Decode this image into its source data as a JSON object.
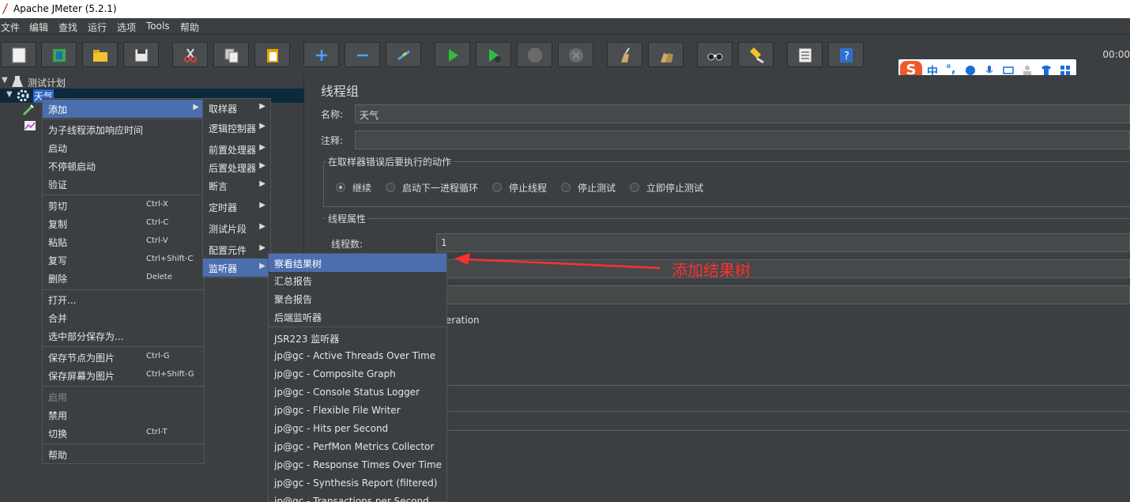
{
  "window": {
    "title": "Apache JMeter (5.2.1)"
  },
  "menubar": {
    "items": [
      "文件",
      "编辑",
      "查找",
      "运行",
      "选项",
      "Tools",
      "帮助"
    ]
  },
  "toolbar": {
    "buttons": [
      "new-icon",
      "templates-icon",
      "open-icon",
      "save-icon",
      "cut-icon",
      "copy-icon",
      "paste-icon",
      "expand-icon",
      "collapse-icon",
      "toggle-icon",
      "start-icon",
      "start-no-pause-icon",
      "stop-icon",
      "shutdown-icon",
      "clear-icon",
      "clear-all-icon",
      "search-icon",
      "reset-search-icon",
      "function-helper-icon",
      "help-icon"
    ],
    "timer": "00:00"
  },
  "ime": {
    "logo": "S",
    "lang": "中",
    "punct": "°,",
    "icons": [
      "emoji-icon",
      "mic-icon",
      "keyboard-icon",
      "user-icon",
      "shirt-icon",
      "apps-icon"
    ]
  },
  "tree": {
    "plan_label": "测试计划",
    "group_label": "天气"
  },
  "right_panel": {
    "title": "线程组",
    "name_label": "名称:",
    "name_value": "天气",
    "comment_label": "注释:",
    "comment_value": "",
    "error_action_title": "在取样器错误后要执行的动作",
    "error_actions": [
      "继续",
      "启动下一进程循环",
      "停止线程",
      "停止测试",
      "立即停止测试"
    ],
    "error_action_selected": 0,
    "thread_props_title": "线程属性",
    "thread_count_label": "线程数:",
    "thread_count_value": "1",
    "partial_text": "eration"
  },
  "context_menu": {
    "items": [
      {
        "label": "添加",
        "shortcut": "",
        "submenu": true
      },
      {
        "label": "为子线程添加响应时间",
        "shortcut": ""
      },
      {
        "label": "启动",
        "shortcut": ""
      },
      {
        "label": "不停顿启动",
        "shortcut": ""
      },
      {
        "label": "验证",
        "shortcut": ""
      },
      {
        "label": "剪切",
        "shortcut": "Ctrl-X"
      },
      {
        "label": "复制",
        "shortcut": "Ctrl-C"
      },
      {
        "label": "粘贴",
        "shortcut": "Ctrl-V"
      },
      {
        "label": "复写",
        "shortcut": "Ctrl+Shift-C"
      },
      {
        "label": "删除",
        "shortcut": "Delete"
      },
      {
        "label": "打开...",
        "shortcut": ""
      },
      {
        "label": "合并",
        "shortcut": ""
      },
      {
        "label": "选中部分保存为...",
        "shortcut": ""
      },
      {
        "label": "保存节点为图片",
        "shortcut": "Ctrl-G"
      },
      {
        "label": "保存屏幕为图片",
        "shortcut": "Ctrl+Shift-G"
      },
      {
        "label": "启用",
        "shortcut": ""
      },
      {
        "label": "禁用",
        "shortcut": ""
      },
      {
        "label": "切换",
        "shortcut": "Ctrl-T"
      },
      {
        "label": "帮助",
        "shortcut": ""
      }
    ]
  },
  "add_submenu": {
    "items": [
      "取样器",
      "逻辑控制器",
      "前置处理器",
      "后置处理器",
      "断言",
      "定时器",
      "测试片段",
      "配置元件",
      "监听器"
    ]
  },
  "listener_submenu": {
    "items": [
      "察看结果树",
      "汇总报告",
      "聚合报告",
      "后端监听器",
      "JSR223 监听器",
      "jp@gc - Active Threads Over Time",
      "jp@gc - Composite Graph",
      "jp@gc - Console Status Logger",
      "jp@gc - Flexible File Writer",
      "jp@gc - Hits per Second",
      "jp@gc - PerfMon Metrics Collector",
      "jp@gc - Response Times Over Time",
      "jp@gc - Synthesis Report (filtered)",
      "jp@gc - Transactions per Second"
    ]
  },
  "annotation": {
    "text": "添加结果树",
    "color": "#ff3030"
  }
}
